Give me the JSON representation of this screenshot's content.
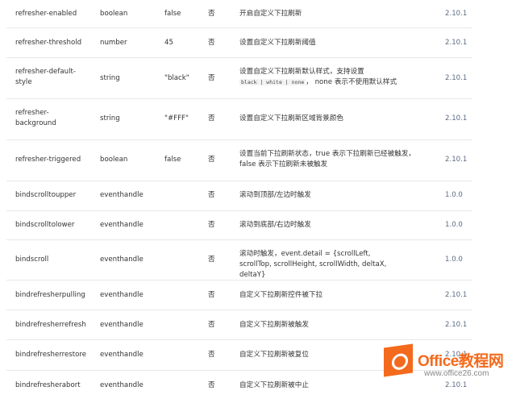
{
  "rows": [
    {
      "attr": "refresher-enabled",
      "type": "boolean",
      "default": "false",
      "required": "否",
      "desc": "开启自定义下拉刷新",
      "version": "2.10.1"
    },
    {
      "attr": "refresher-threshold",
      "type": "number",
      "default": "45",
      "required": "否",
      "desc": "设置自定义下拉刷新阈值",
      "version": "2.10.1"
    },
    {
      "attr": "refresher-default-style",
      "type": "string",
      "default": "\"black\"",
      "required": "否",
      "desc": "设置自定义下拉刷新默认样式，支持设置",
      "desc_code": "black | white | none",
      "desc_tail": "， none 表示不使用默认样式",
      "version": "2.10.1"
    },
    {
      "attr": "refresher-background",
      "type": "string",
      "default": "\"#FFF\"",
      "required": "否",
      "desc": "设置自定义下拉刷新区域背景颜色",
      "version": "2.10.1"
    },
    {
      "attr": "refresher-triggered",
      "type": "boolean",
      "default": "false",
      "required": "否",
      "desc": "设置当前下拉刷新状态，true 表示下拉刷新已经被触发，false 表示下拉刷新未被触发",
      "version": "2.10.1"
    },
    {
      "attr": "bindscrolltoupper",
      "type": "eventhandle",
      "default": "",
      "required": "否",
      "desc": "滚动到顶部/左边时触发",
      "version": "1.0.0"
    },
    {
      "attr": "bindscrolltolower",
      "type": "eventhandle",
      "default": "",
      "required": "否",
      "desc": "滚动到底部/右边时触发",
      "version": "1.0.0"
    },
    {
      "attr": "bindscroll",
      "type": "eventhandle",
      "default": "",
      "required": "否",
      "desc": "滚动时触发，event.detail = {scrollLeft, scrollTop, scrollHeight, scrollWidth, deltaX, deltaY}",
      "version": "1.0.0"
    },
    {
      "attr": "bindrefresherpulling",
      "type": "eventhandle",
      "default": "",
      "required": "否",
      "desc": "自定义下拉刷新控件被下拉",
      "version": "2.10.1"
    },
    {
      "attr": "bindrefresherrefresh",
      "type": "eventhandle",
      "default": "",
      "required": "否",
      "desc": "自定义下拉刷新被触发",
      "version": "2.10.1"
    },
    {
      "attr": "bindrefresherrestore",
      "type": "eventhandle",
      "default": "",
      "required": "否",
      "desc": "自定义下拉刷新被复位",
      "version": "2.10.1"
    },
    {
      "attr": "bindrefresherabort",
      "type": "eventhandle",
      "default": "",
      "required": "否",
      "desc": "自定义下拉刷新被中止",
      "version": "2.10.1"
    }
  ],
  "watermark": {
    "brand": "Office教程网",
    "domain": "www.office26.com"
  }
}
